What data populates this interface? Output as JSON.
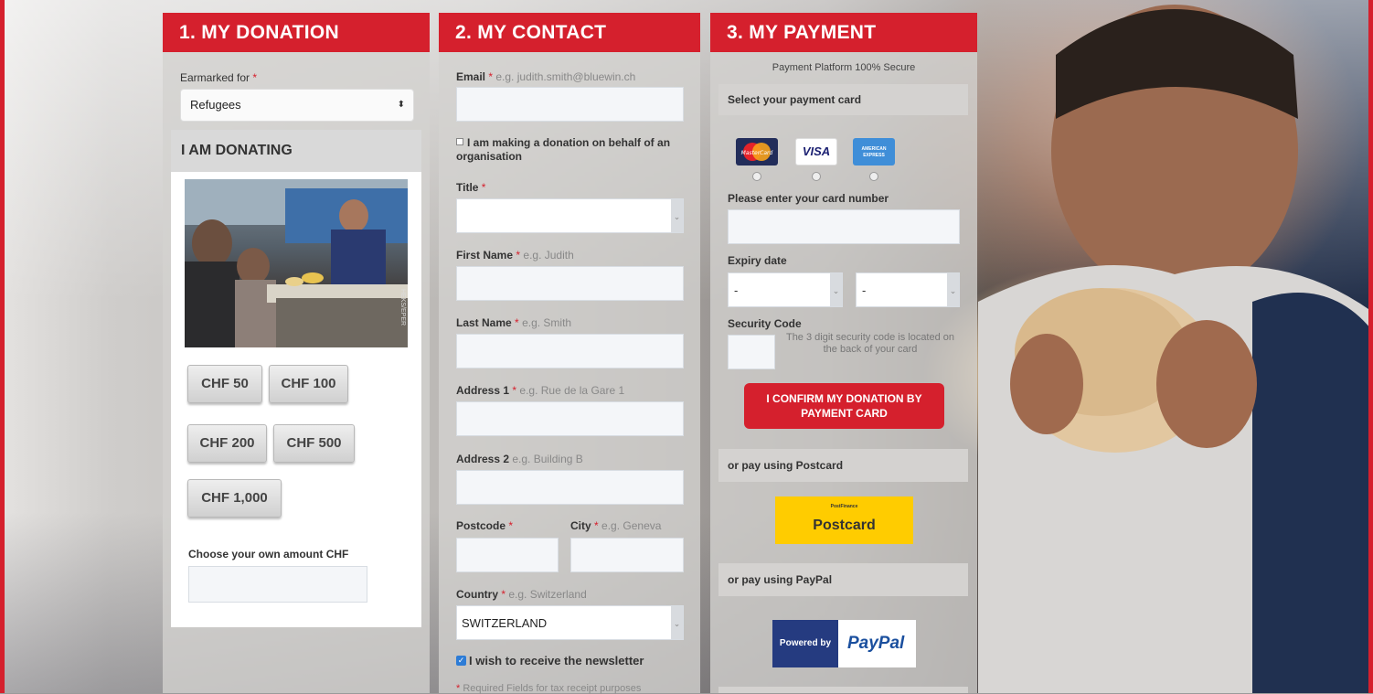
{
  "donation": {
    "header": "1. MY DONATION",
    "earmarked_label": "Earmarked for",
    "required_mark": "*",
    "earmarked_value": "Refugees",
    "donating_title": "I AM DONATING",
    "amounts": [
      "CHF 50",
      "CHF 100",
      "CHF 200",
      "CHF 500",
      "CHF 1,000"
    ],
    "own_amount_label": "Choose your own amount",
    "own_amount_currency": "CHF",
    "photo_credit": "HEKS/EPER"
  },
  "contact": {
    "header": "2. MY CONTACT",
    "email_label": "Email",
    "email_eg": "e.g. judith.smith@bluewin.ch",
    "org_checkbox_label": "I am making a donation on behalf of an organisation",
    "title_label": "Title",
    "first_name_label": "First Name",
    "first_name_eg": "e.g. Judith",
    "last_name_label": "Last Name",
    "last_name_eg": "e.g. Smith",
    "address1_label": "Address 1",
    "address1_eg": "e.g. Rue de la Gare 1",
    "address2_label": "Address 2",
    "address2_eg": "e.g. Building B",
    "postcode_label": "Postcode",
    "city_label": "City",
    "city_eg": "e.g. Geneva",
    "country_label": "Country",
    "country_eg": "e.g. Switzerland",
    "country_value": "SWITZERLAND",
    "newsletter_label": "I wish to receive the newsletter",
    "required_note": "Required Fields for tax receipt purposes",
    "required_mark": "*"
  },
  "payment": {
    "header": "3. MY PAYMENT",
    "secure_note": "Payment Platform 100% Secure",
    "select_card_label": "Select your payment card",
    "cards": [
      "MasterCard",
      "VISA",
      "AMERICAN EXPRESS"
    ],
    "card_number_label": "Please enter your card number",
    "expiry_label": "Expiry date",
    "expiry_month": "-",
    "expiry_year": "-",
    "security_label": "Security Code",
    "security_help": "The 3 digit security code is located on the back of your card",
    "confirm_button": "I CONFIRM MY DONATION BY PAYMENT CARD",
    "postcard_label": "or pay using Postcard",
    "postcard_brand_small": "PostFinance",
    "postcard_brand": "Postcard",
    "paypal_label": "or pay using PayPal",
    "paypal_powered": "Powered by",
    "paypal_brand": "PayPal"
  },
  "colors": {
    "accent": "#d5202d",
    "paypal_blue": "#253b80",
    "postcard_yellow": "#ffcc00"
  }
}
